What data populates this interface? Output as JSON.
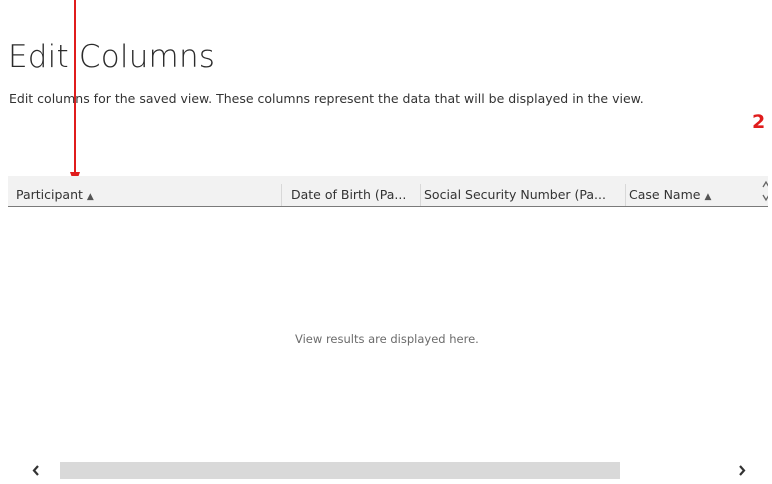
{
  "header": {
    "title": "Edit Columns",
    "subtitle": "Edit columns for the saved view. These columns represent the data that will be displayed in the view."
  },
  "annotation": {
    "number": "2",
    "color": "#e01c1c"
  },
  "grid": {
    "columns": [
      {
        "label": "Participant",
        "sort": "ascending"
      },
      {
        "label": "Date of Birth (Pa...",
        "sort": "none"
      },
      {
        "label": "Social Security Number (Pa...",
        "sort": "none"
      },
      {
        "label": "Case Name",
        "sort": "ascending"
      }
    ],
    "empty_message": "View results are displayed here."
  },
  "icons": {
    "sort": "sort-ascending-icon",
    "scroll_toggle": "chevron-up-down-icon",
    "scroll_left": "chevron-left-icon",
    "scroll_right": "chevron-right-icon"
  },
  "colors": {
    "header_bg": "#f2f2f2",
    "scroll_thumb": "#d9d9d9",
    "text": "#333333"
  }
}
